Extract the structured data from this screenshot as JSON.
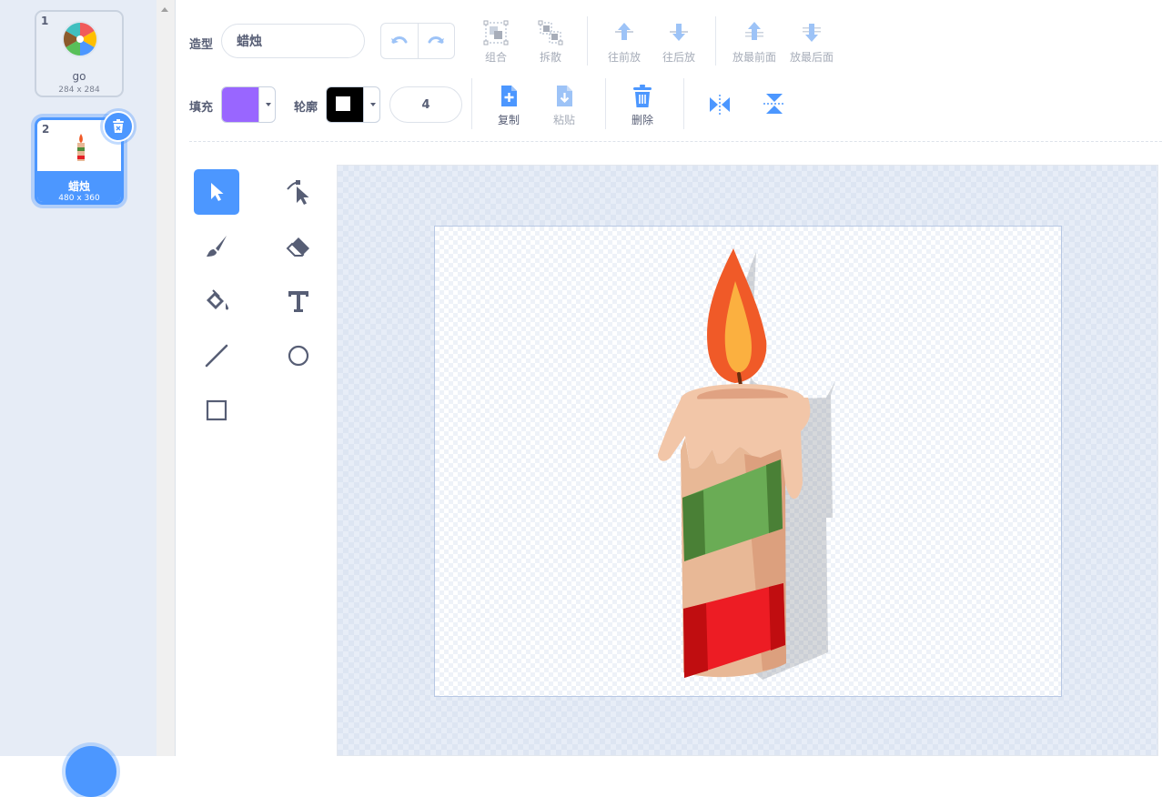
{
  "costume_list": {
    "items": [
      {
        "number": "1",
        "name": "go",
        "size": "284 x 284",
        "selected": false
      },
      {
        "number": "2",
        "name": "蜡烛",
        "size": "480 x 360",
        "selected": true
      }
    ]
  },
  "toolbar": {
    "costume_label": "造型",
    "costume_name": "蜡烛",
    "group_label": "组合",
    "ungroup_label": "拆散",
    "forward_label": "往前放",
    "backward_label": "往后放",
    "front_label": "放最前面",
    "back_label": "放最后面",
    "fill_label": "填充",
    "outline_label": "轮廓",
    "stroke_width": "4",
    "copy_label": "复制",
    "paste_label": "粘贴",
    "delete_label": "删除"
  },
  "colors": {
    "accent": "#4c97ff",
    "fill_color": "#9966ff",
    "outline_color": "#000000",
    "text": "#575e75",
    "disabled": "#a7adb9"
  },
  "tools": [
    "select-tool",
    "reshape-tool",
    "brush-tool",
    "eraser-tool",
    "fill-tool",
    "text-tool",
    "line-tool",
    "circle-tool",
    "rectangle-tool"
  ],
  "active_tool": "select-tool"
}
